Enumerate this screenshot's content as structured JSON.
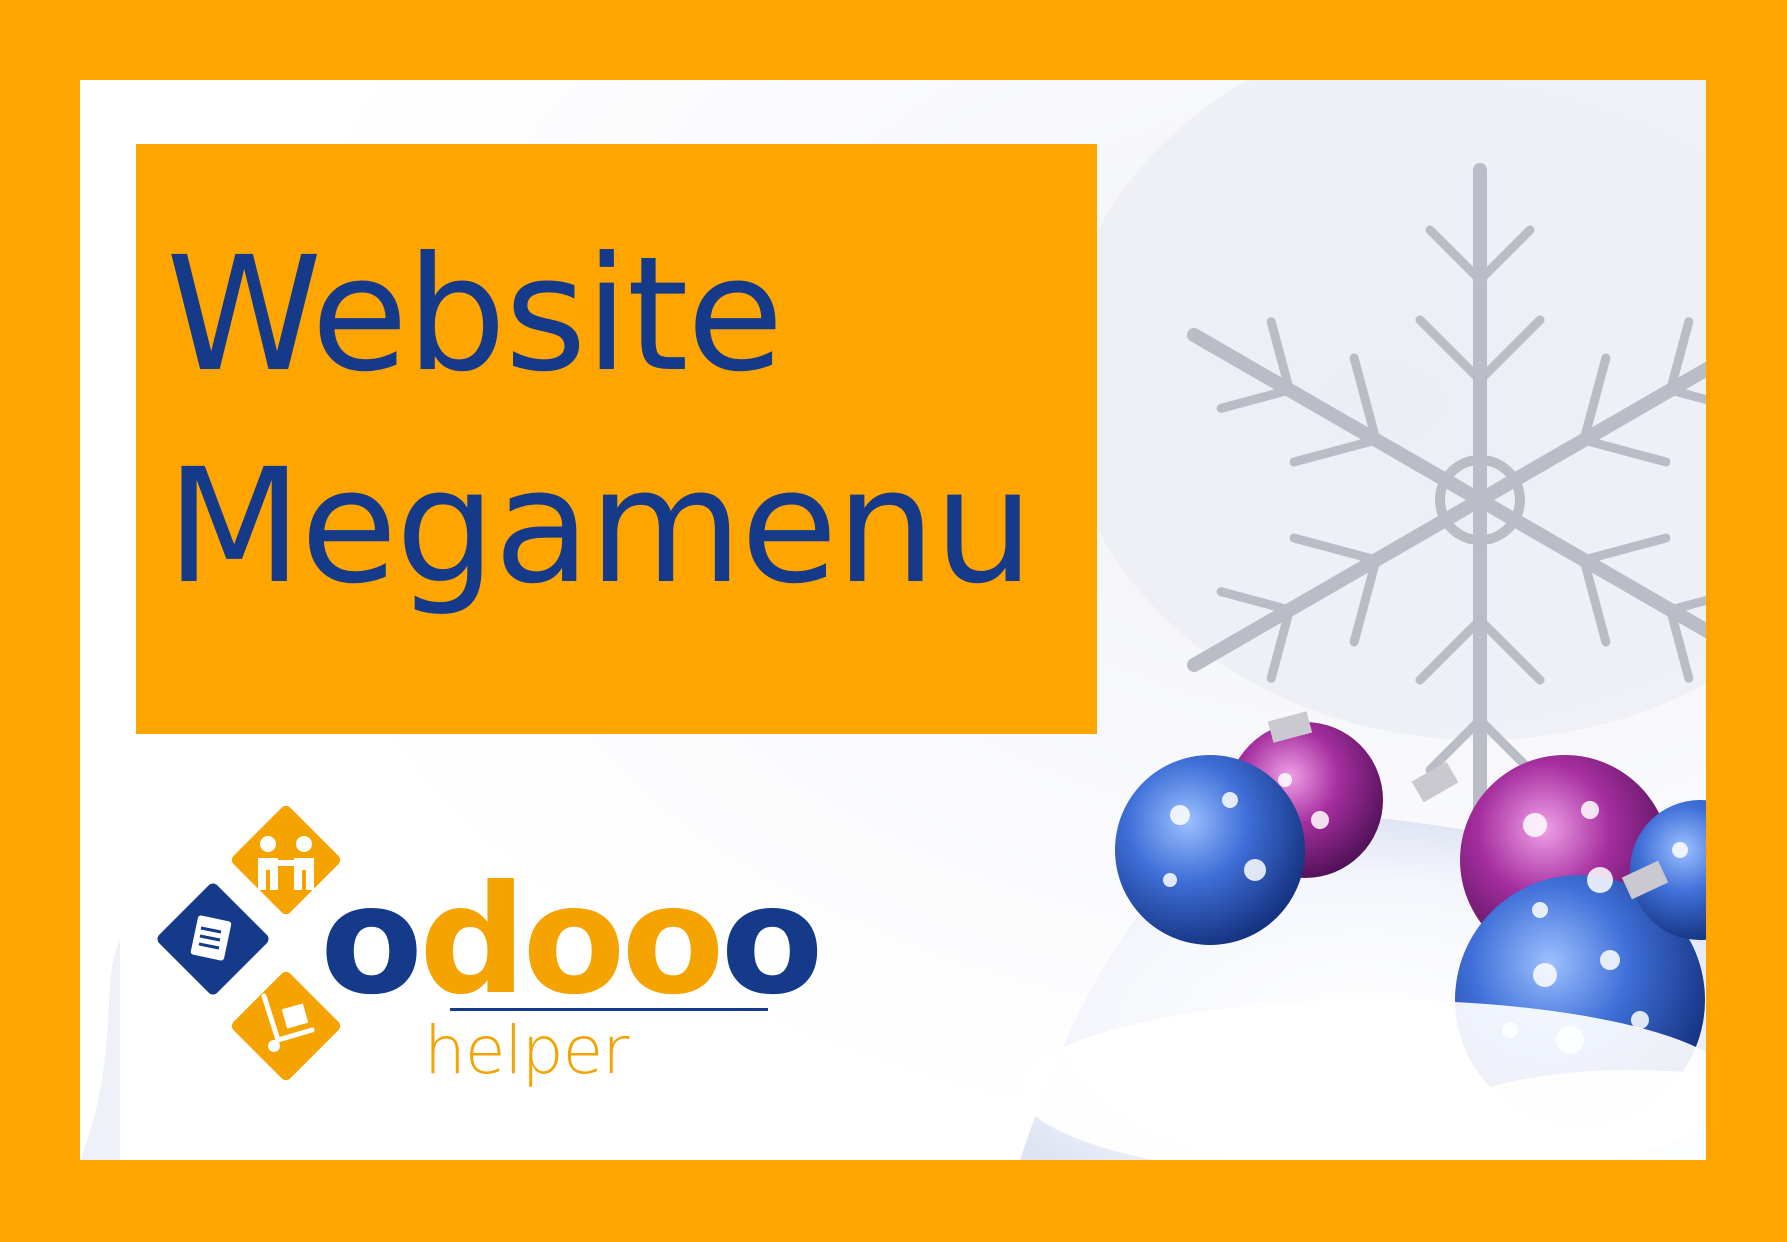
{
  "title": {
    "line1": "Website",
    "line2": "Megamenu"
  },
  "logo": {
    "wordmark_first": "o",
    "wordmark_rest": "doo",
    "wordmark_last": "o",
    "subtitle": "helper"
  },
  "colors": {
    "border": "#FFA500",
    "title_text": "#153a8a",
    "logo_orange": "#F5A300",
    "logo_blue": "#153a8a"
  },
  "icons": [
    "snowflake-ornament",
    "christmas-bauble",
    "people-icon",
    "book-icon",
    "hand-truck-icon"
  ]
}
